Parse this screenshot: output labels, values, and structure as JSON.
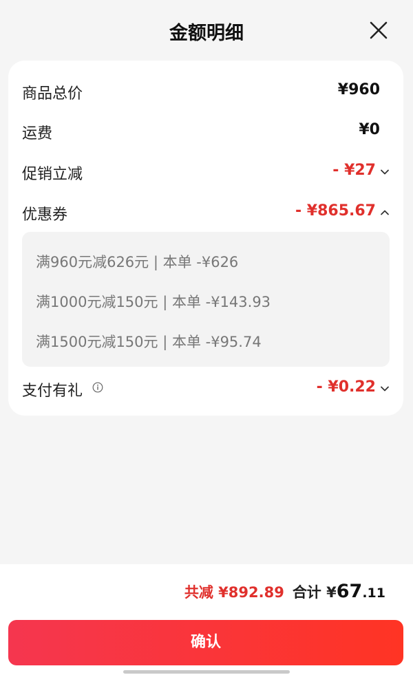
{
  "header": {
    "title": "金额明细"
  },
  "rows": {
    "goods_total": {
      "label": "商品总价",
      "value": "¥960"
    },
    "shipping": {
      "label": "运费",
      "value": "¥0"
    },
    "promo": {
      "label": "促销立减",
      "value": "- ¥27"
    },
    "coupon": {
      "label": "优惠券",
      "value": "- ¥865.67"
    },
    "pay_gift": {
      "label": "支付有礼",
      "value": "- ¥0.22"
    }
  },
  "coupons": [
    "满960元减626元 | 本单 -¥626",
    "满1000元减150元 | 本单 -¥143.93",
    "满1500元减150元 | 本单 -¥95.74"
  ],
  "footer": {
    "total_reduction": "共减 ¥892.89",
    "sum_label": "合计 ¥",
    "sum_int": "67",
    "sum_dec": ".11",
    "confirm_label": "确认"
  },
  "colors": {
    "accent": "#e0302c",
    "button_start": "#f5364f",
    "button_end": "#ff3424"
  },
  "icons": {
    "close": "close-icon",
    "chevron_down": "chevron-down-icon",
    "chevron_up": "chevron-up-icon",
    "info": "info-icon"
  }
}
